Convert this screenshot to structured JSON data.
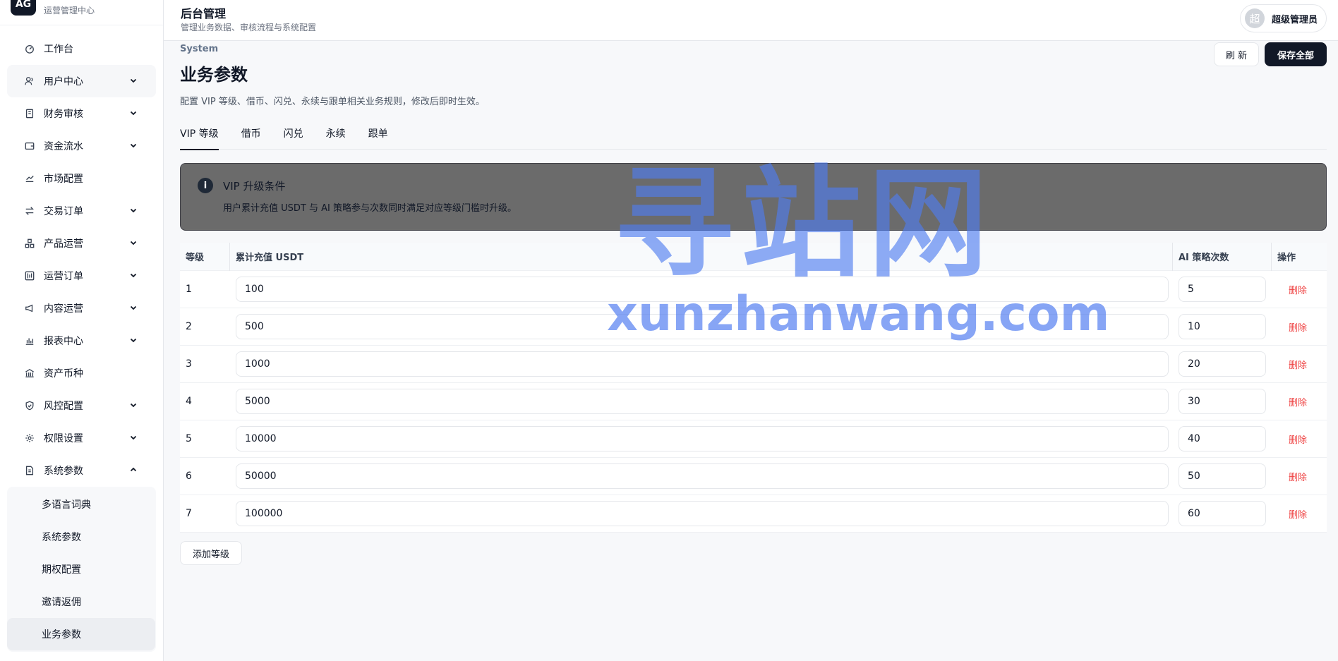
{
  "brand": {
    "logo": "AG",
    "subtitle": "运营管理中心"
  },
  "header": {
    "title": "后台管理",
    "subtitle": "管理业务数据、审核流程与系统配置",
    "user_avatar": "超",
    "user_name": "超级管理员"
  },
  "sidebar": {
    "items": [
      {
        "label": "工作台",
        "icon": "dashboard-icon",
        "chevron": ""
      },
      {
        "label": "用户中心",
        "icon": "users-icon",
        "chevron": "down"
      },
      {
        "label": "财务审核",
        "icon": "receipt-icon",
        "chevron": "down"
      },
      {
        "label": "资金流水",
        "icon": "wallet-icon",
        "chevron": "down"
      },
      {
        "label": "市场配置",
        "icon": "chart-line-icon",
        "chevron": ""
      },
      {
        "label": "交易订单",
        "icon": "swap-icon",
        "chevron": "down"
      },
      {
        "label": "产品运营",
        "icon": "boxes-icon",
        "chevron": "down"
      },
      {
        "label": "运营订单",
        "icon": "candlestick-icon",
        "chevron": "down"
      },
      {
        "label": "内容运营",
        "icon": "megaphone-icon",
        "chevron": "down"
      },
      {
        "label": "报表中心",
        "icon": "bar-chart-icon",
        "chevron": "down"
      },
      {
        "label": "资产币种",
        "icon": "bank-icon",
        "chevron": ""
      },
      {
        "label": "风控配置",
        "icon": "shield-icon",
        "chevron": "down"
      },
      {
        "label": "权限设置",
        "icon": "gear-icon",
        "chevron": "down"
      },
      {
        "label": "系统参数",
        "icon": "file-settings-icon",
        "chevron": "up"
      }
    ],
    "submenu": [
      {
        "label": "多语言词典"
      },
      {
        "label": "系统参数"
      },
      {
        "label": "期权配置"
      },
      {
        "label": "邀请返佣"
      },
      {
        "label": "业务参数"
      }
    ]
  },
  "page": {
    "eyebrow": "System",
    "title": "业务参数",
    "description": "配置 VIP 等级、借币、闪兑、永续与跟单相关业务规则，修改后即时生效。",
    "refresh_label": "刷 新",
    "save_label": "保存全部"
  },
  "tabs": [
    {
      "label": "VIP 等级",
      "active": true
    },
    {
      "label": "借币",
      "active": false
    },
    {
      "label": "闪兑",
      "active": false
    },
    {
      "label": "永续",
      "active": false
    },
    {
      "label": "跟单",
      "active": false
    }
  ],
  "alert": {
    "title": "VIP 升级条件",
    "description": "用户累计充值 USDT 与 AI 策略参与次数同时满足对应等级门槛时升级。"
  },
  "table": {
    "headers": [
      "等级",
      "累计充值 USDT",
      "AI 策略次数",
      "操作"
    ],
    "rows": [
      {
        "level": "1",
        "usdt": "100",
        "ai": "5",
        "action": "删除"
      },
      {
        "level": "2",
        "usdt": "500",
        "ai": "10",
        "action": "删除"
      },
      {
        "level": "3",
        "usdt": "1000",
        "ai": "20",
        "action": "删除"
      },
      {
        "level": "4",
        "usdt": "5000",
        "ai": "30",
        "action": "删除"
      },
      {
        "level": "5",
        "usdt": "10000",
        "ai": "40",
        "action": "删除"
      },
      {
        "level": "6",
        "usdt": "50000",
        "ai": "50",
        "action": "删除"
      },
      {
        "level": "7",
        "usdt": "100000",
        "ai": "60",
        "action": "删除"
      }
    ]
  },
  "add_level_label": "添加等级",
  "watermark": {
    "cn": "寻站网",
    "en": "xunzhanwang.com"
  }
}
